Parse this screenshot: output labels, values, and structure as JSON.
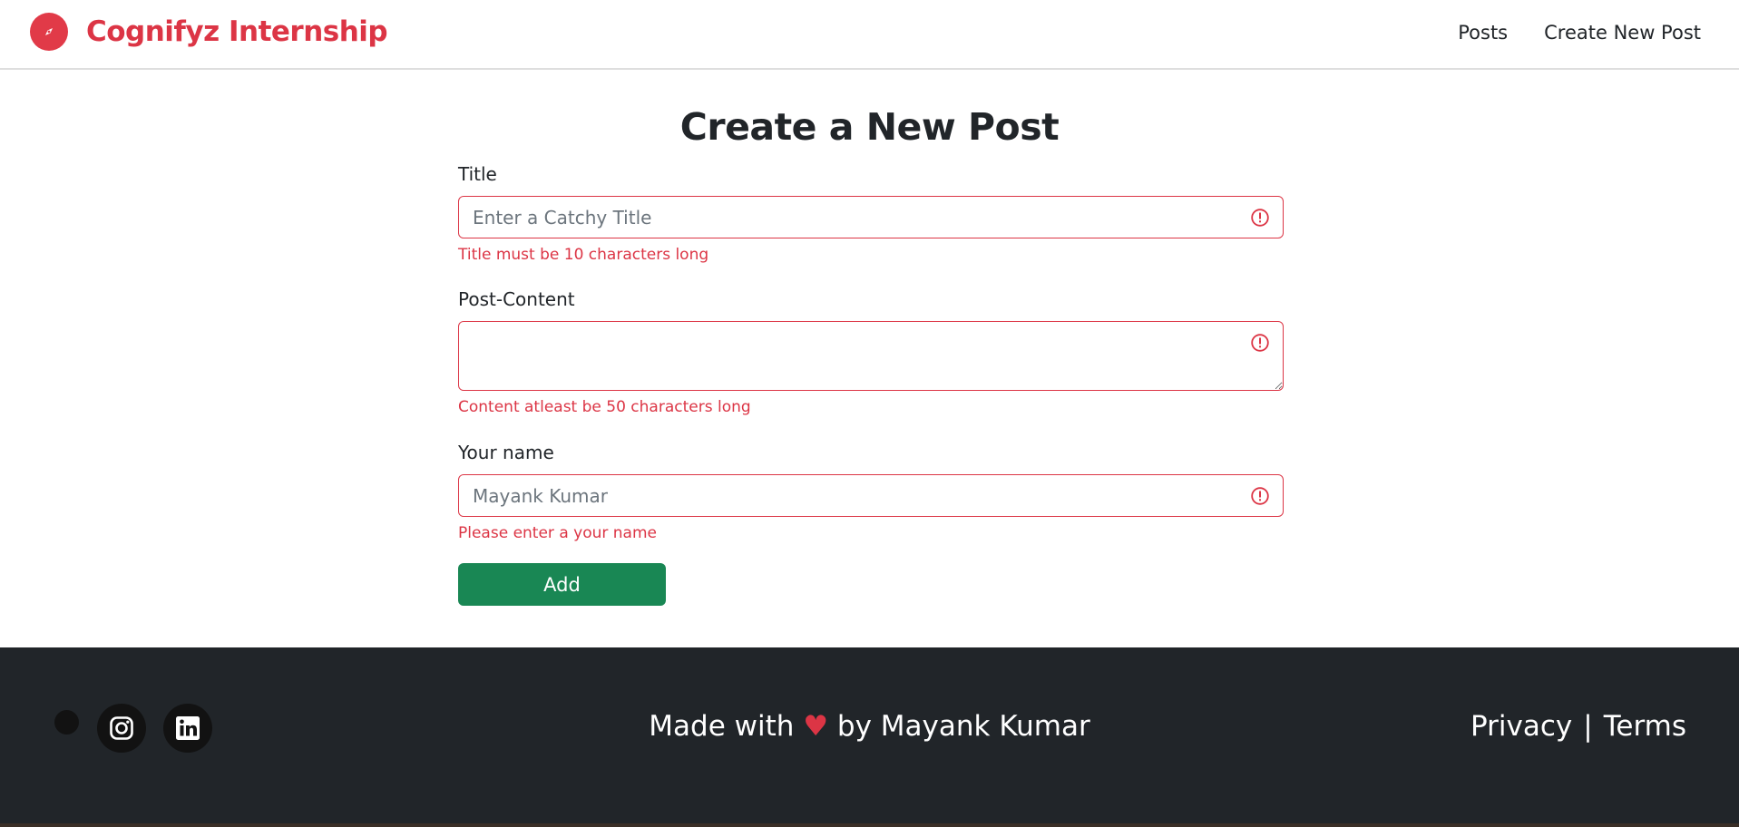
{
  "header": {
    "brand_name": "Cognifyz Internship",
    "nav": [
      {
        "label": "Posts"
      },
      {
        "label": "Create New Post"
      }
    ]
  },
  "form": {
    "title": "Create a New Post",
    "fields": {
      "title": {
        "label": "Title",
        "placeholder": "Enter a Catchy Title",
        "value": "",
        "error": "Title must be 10 characters long"
      },
      "content": {
        "label": "Post-Content",
        "placeholder": "",
        "value": "",
        "error": "Content atleast be 50 characters long"
      },
      "name": {
        "label": "Your name",
        "placeholder": "Mayank Kumar",
        "value": "",
        "error": "Please enter a your name"
      }
    },
    "submit_label": "Add"
  },
  "footer": {
    "made_with_prefix": "Made with",
    "heart": "♥",
    "made_with_suffix": "by Mayank Kumar",
    "privacy": "Privacy",
    "separator": "|",
    "terms": "Terms",
    "social_icons": [
      "dot-icon",
      "instagram-icon",
      "linkedin-icon"
    ]
  },
  "colors": {
    "brand": "#dc3545",
    "success": "#198754",
    "footer_bg": "#212529"
  }
}
